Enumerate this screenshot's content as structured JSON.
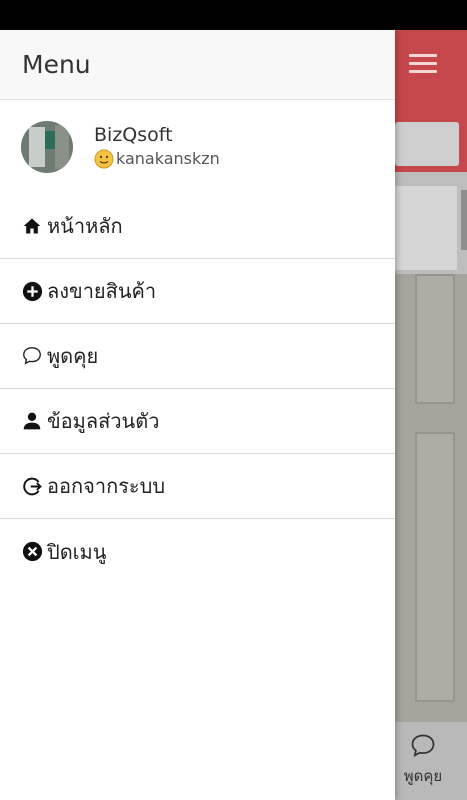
{
  "drawer": {
    "title": "Menu",
    "profile": {
      "name": "BizQsoft",
      "username": "kanakanskzn"
    },
    "items": [
      {
        "label": "หน้าหลัก",
        "icon": "home-icon"
      },
      {
        "label": "ลงขายสินค้า",
        "icon": "plus-circle-icon"
      },
      {
        "label": "พูดคุย",
        "icon": "chat-icon"
      },
      {
        "label": "ข้อมูลส่วนตัว",
        "icon": "user-icon"
      },
      {
        "label": "ออกจากระบบ",
        "icon": "logout-icon"
      },
      {
        "label": "ปิดเมนู",
        "icon": "close-circle-icon"
      }
    ]
  },
  "background": {
    "chat_label": "พูดคุย"
  },
  "colors": {
    "header_accent": "#c6474c",
    "drawer_bg": "#ffffff",
    "text": "#222222"
  }
}
